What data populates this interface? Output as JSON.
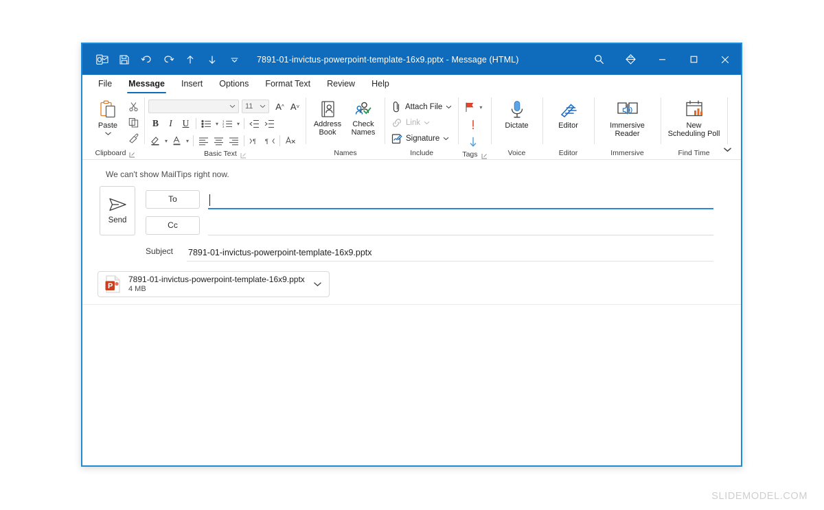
{
  "window": {
    "title": "7891-01-invictus-powerpoint-template-16x9.pptx  -  Message (HTML)",
    "accent_color": "#0f6cbd",
    "border_color": "#1e8bd4"
  },
  "quick_access": [
    {
      "name": "outlook-app-icon",
      "tooltip": "Outlook"
    },
    {
      "name": "save-icon",
      "tooltip": "Save"
    },
    {
      "name": "undo-icon",
      "tooltip": "Undo"
    },
    {
      "name": "redo-icon",
      "tooltip": "Redo"
    },
    {
      "name": "previous-item-icon",
      "tooltip": "Previous Item"
    },
    {
      "name": "next-item-icon",
      "tooltip": "Next Item"
    },
    {
      "name": "customize-quick-access-toolbar-icon",
      "tooltip": "Customize Quick Access Toolbar"
    }
  ],
  "title_bar_right": [
    {
      "name": "search-icon",
      "tooltip": "Search"
    },
    {
      "name": "diamond-icon",
      "tooltip": "Microsoft 365"
    }
  ],
  "window_controls": [
    {
      "name": "minimize-button",
      "glyph": "—"
    },
    {
      "name": "maximize-button",
      "glyph": "□"
    },
    {
      "name": "close-button",
      "glyph": "✕"
    }
  ],
  "tabs": [
    {
      "label": "File",
      "active": false
    },
    {
      "label": "Message",
      "active": true
    },
    {
      "label": "Insert",
      "active": false
    },
    {
      "label": "Options",
      "active": false
    },
    {
      "label": "Format Text",
      "active": false
    },
    {
      "label": "Review",
      "active": false
    },
    {
      "label": "Help",
      "active": false
    }
  ],
  "ribbon": {
    "groups": {
      "clipboard": {
        "label": "Clipboard",
        "paste_label": "Paste",
        "cut_tooltip": "Cut",
        "copy_tooltip": "Copy",
        "format_painter_tooltip": "Format Painter",
        "dialog_launcher": "Clipboard settings"
      },
      "basic_text": {
        "label": "Basic Text",
        "font_name": "",
        "font_name_placeholder": "",
        "font_size": "11",
        "grow_font": "A",
        "shrink_font": "A",
        "bold": "B",
        "italic": "I",
        "underline": "U",
        "dialog_launcher": "Font settings"
      },
      "names": {
        "label": "Names",
        "address_book": "Address\nBook",
        "address_book_line1": "Address",
        "address_book_line2": "Book",
        "check_names_line1": "Check",
        "check_names_line2": "Names"
      },
      "include": {
        "label": "Include",
        "attach_file": "Attach File",
        "link": "Link",
        "signature": "Signature"
      },
      "tags": {
        "label": "Tags",
        "follow_up_tooltip": "Follow Up",
        "high_importance_glyph": "!",
        "low_importance_tooltip": "Low Importance",
        "dialog_launcher": "Tags settings"
      },
      "voice": {
        "label": "Voice",
        "dictate": "Dictate"
      },
      "editor": {
        "label": "Editor",
        "editor": "Editor"
      },
      "immersive": {
        "label": "Immersive",
        "immersive_reader_line1": "Immersive",
        "immersive_reader_line2": "Reader"
      },
      "find_time": {
        "label": "Find Time",
        "poll_line1": "New",
        "poll_line2": "Scheduling Poll"
      }
    },
    "collapse_tooltip": "Collapse the Ribbon"
  },
  "compose": {
    "mailtips": "We can't show MailTips right now.",
    "send_label": "Send",
    "to_label": "To",
    "to_value": "",
    "cc_label": "Cc",
    "cc_value": "",
    "subject_label": "Subject",
    "subject_value": "7891-01-invictus-powerpoint-template-16x9.pptx",
    "attachment": {
      "file_name": "7891-01-invictus-powerpoint-template-16x9.pptx",
      "file_size": "4 MB",
      "file_type": "powerpoint",
      "icon_color": "#c8401f"
    },
    "body_text": ""
  },
  "watermark": "SLIDEMODEL.COM"
}
